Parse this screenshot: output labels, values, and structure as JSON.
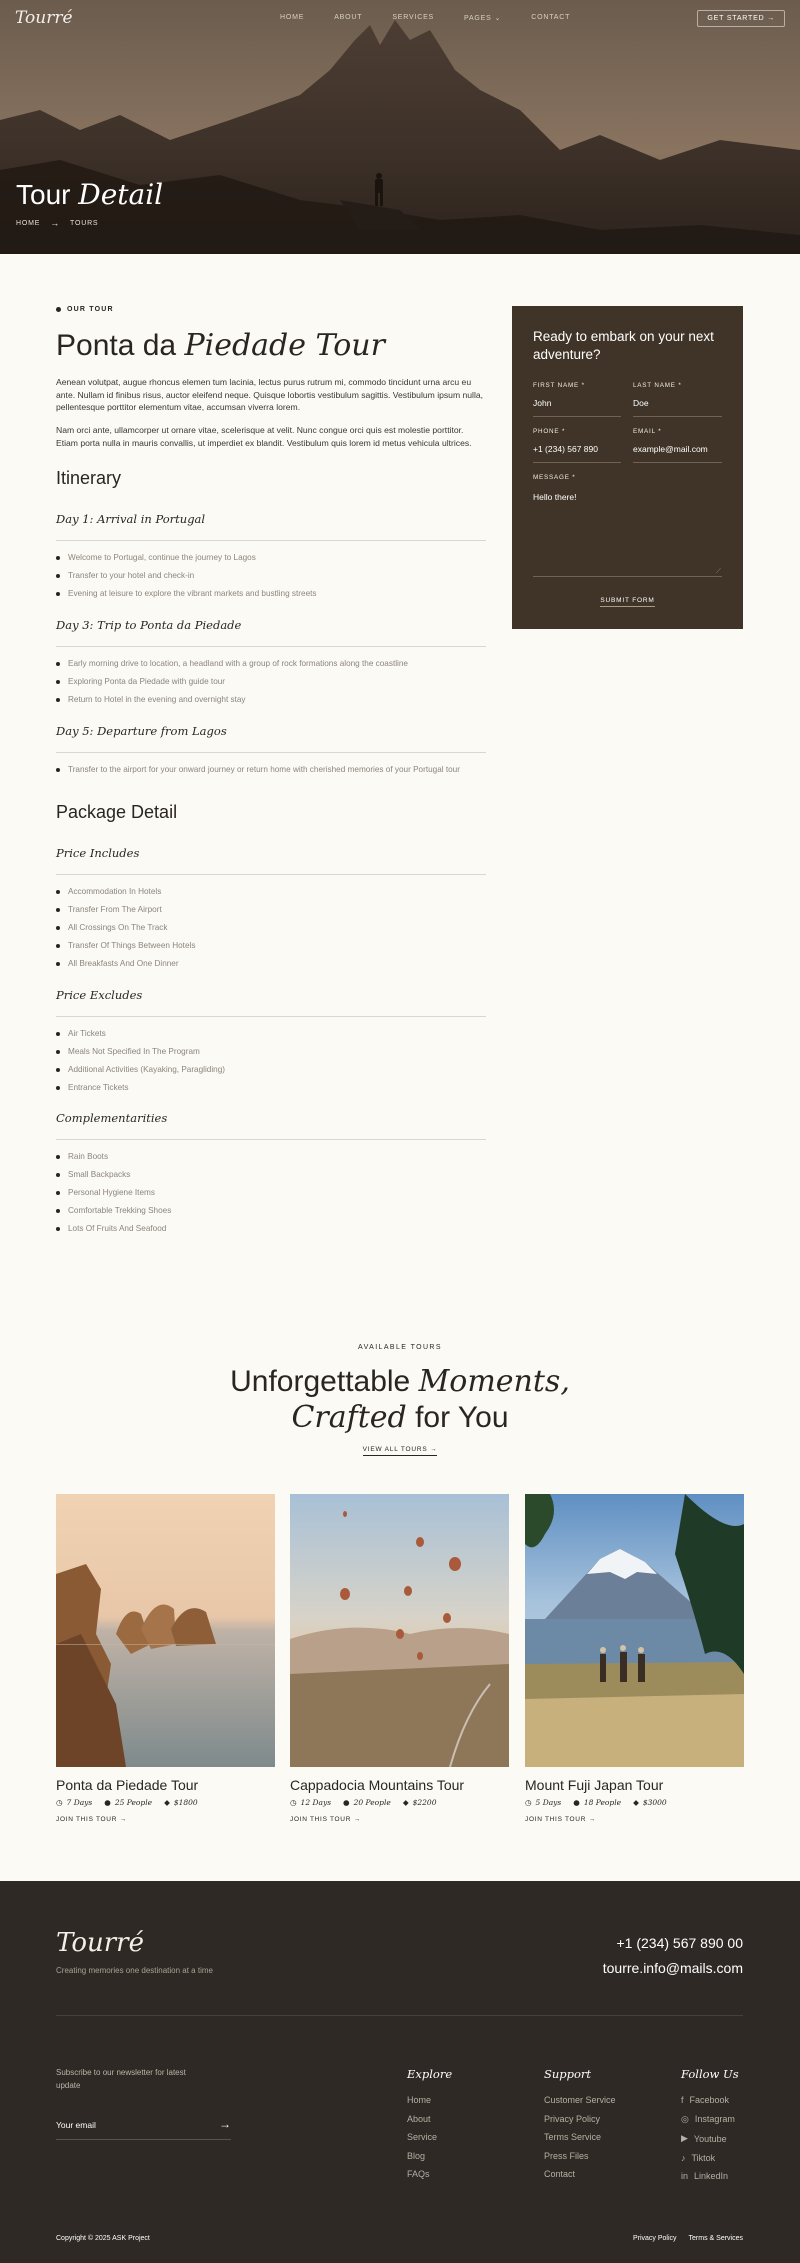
{
  "nav": {
    "logo": "Tourré",
    "items": [
      "HOME",
      "ABOUT",
      "SERVICES",
      "PAGES",
      "CONTACT"
    ],
    "cta": "GET STARTED"
  },
  "hero": {
    "title_plain": "Tour ",
    "title_italic": "Detail",
    "crumb_home": "HOME",
    "crumb_current": "TOURS"
  },
  "detail": {
    "eyebrow": "OUR TOUR",
    "title_plain": "Ponta da ",
    "title_italic": "Piedade Tour",
    "para1": "Aenean volutpat, augue rhoncus elemen tum lacinia, lectus purus rutrum mi, commodo tincidunt urna arcu eu ante. Nullam id finibus risus, auctor eleifend neque. Quisque lobortis vestibulum sagittis. Vestibulum ipsum nulla, pellentesque porttitor elementum vitae, accumsan viverra lorem.",
    "para2": "Nam orci ante, ullamcorper ut ornare vitae, scelerisque at velit. Nunc congue orci quis est molestie porttitor. Etiam porta nulla in mauris convallis, ut imperdiet ex blandit. Vestibulum quis lorem id metus vehicula ultrices.",
    "itinerary_heading": "Itinerary",
    "days": [
      {
        "title": "Day 1: Arrival in Portugal",
        "items": [
          "Welcome to Portugal, continue the journey to Lagos",
          "Transfer to your hotel and check-in",
          "Evening at leisure to explore the vibrant markets and bustling streets"
        ]
      },
      {
        "title": "Day 3: Trip to Ponta da Piedade",
        "items": [
          "Early morning drive to location, a headland with a group of rock formations along the coastline",
          "Exploring Ponta da Piedade with guide tour",
          "Return to Hotel in the evening and overnight stay"
        ]
      },
      {
        "title": "Day 5: Departure from Lagos",
        "items": [
          "Transfer to the airport for your onward journey or return home with cherished memories of your Portugal tour"
        ]
      }
    ],
    "package_heading": "Package Detail",
    "packages": [
      {
        "title": "Price Includes",
        "items": [
          "Accommodation In Hotels",
          "Transfer From The Airport",
          "All Crossings On The Track",
          "Transfer Of Things Between Hotels",
          "All Breakfasts And One Dinner"
        ]
      },
      {
        "title": "Price Excludes",
        "items": [
          "Air Tickets",
          "Meals Not Specified In The Program",
          "Additional Activities (Kayaking, Paragliding)",
          "Entrance Tickets"
        ]
      },
      {
        "title": "Complementarities",
        "items": [
          "Rain Boots",
          "Small Backpacks",
          "Personal Hygiene Items",
          "Comfortable Trekking Shoes",
          "Lots Of Fruits And Seafood"
        ]
      }
    ]
  },
  "form": {
    "heading": "Ready to embark on your next adventure?",
    "first_name_label": "FIRST NAME *",
    "first_name_value": "John",
    "last_name_label": "LAST NAME *",
    "last_name_value": "Doe",
    "phone_label": "PHONE *",
    "phone_value": "+1 (234) 567 890",
    "email_label": "EMAIL *",
    "email_value": "example@mail.com",
    "message_label": "MESSAGE *",
    "message_value": "Hello there!",
    "submit": "SUBMIT FORM"
  },
  "tours": {
    "eyebrow": "AVAILABLE TOURS",
    "title_line1_plain": "Unforgettable ",
    "title_line1_italic": "Moments,",
    "title_line2_italic": "Crafted",
    "title_line2_plain": " for You",
    "view_all": "VIEW ALL TOURS",
    "cards": [
      {
        "title": "Ponta da Piedade Tour",
        "days": "7 Days",
        "people": "25 People",
        "price": "$1800",
        "join": "JOIN THIS TOUR"
      },
      {
        "title": "Cappadocia Mountains Tour",
        "days": "12 Days",
        "people": "20 People",
        "price": "$2200",
        "join": "JOIN THIS TOUR"
      },
      {
        "title": "Mount Fuji Japan Tour",
        "days": "5 Days",
        "people": "18 People",
        "price": "$3000",
        "join": "JOIN THIS TOUR"
      }
    ]
  },
  "footer": {
    "logo": "Tourré",
    "tagline": "Creating memories one destination at a time",
    "phone": "+1 (234) 567 890 00",
    "email": "tourre.info@mails.com",
    "subscribe_text": "Subscribe to our newsletter for latest update",
    "email_placeholder": "Your email",
    "explore_title": "Explore",
    "explore": [
      "Home",
      "About",
      "Service",
      "Blog",
      "FAQs"
    ],
    "support_title": "Support",
    "support": [
      "Customer Service",
      "Privacy Policy",
      "Terms Service",
      "Press Files",
      "Contact"
    ],
    "follow_title": "Follow Us",
    "follow": [
      "Facebook",
      "Instagram",
      "Youtube",
      "Tiktok",
      "LinkedIn"
    ],
    "copyright": "Copyright © 2025 ASK Project",
    "privacy": "Privacy Policy",
    "terms": "Terms & Services"
  }
}
